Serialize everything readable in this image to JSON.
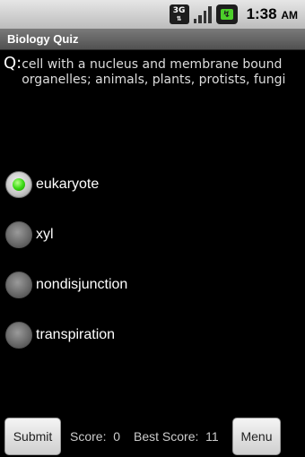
{
  "status_bar": {
    "network": "3G",
    "time": "1:38",
    "ampm": "AM"
  },
  "app": {
    "title": "Biology Quiz"
  },
  "question": {
    "label": "Q:",
    "text": "cell with a nucleus and membrane bound organelles; animals, plants, protists, fungi"
  },
  "options": [
    {
      "label": "eukaryote",
      "selected": true
    },
    {
      "label": "xyl",
      "selected": false
    },
    {
      "label": "nondisjunction",
      "selected": false
    },
    {
      "label": "transpiration",
      "selected": false
    }
  ],
  "footer": {
    "submit_label": "Submit",
    "score_label": "Score:",
    "score_value": "0",
    "best_label": "Best Score:",
    "best_value": "11",
    "menu_label": "Menu"
  },
  "colors": {
    "accent_green": "#3ddc16",
    "background": "#000000"
  }
}
